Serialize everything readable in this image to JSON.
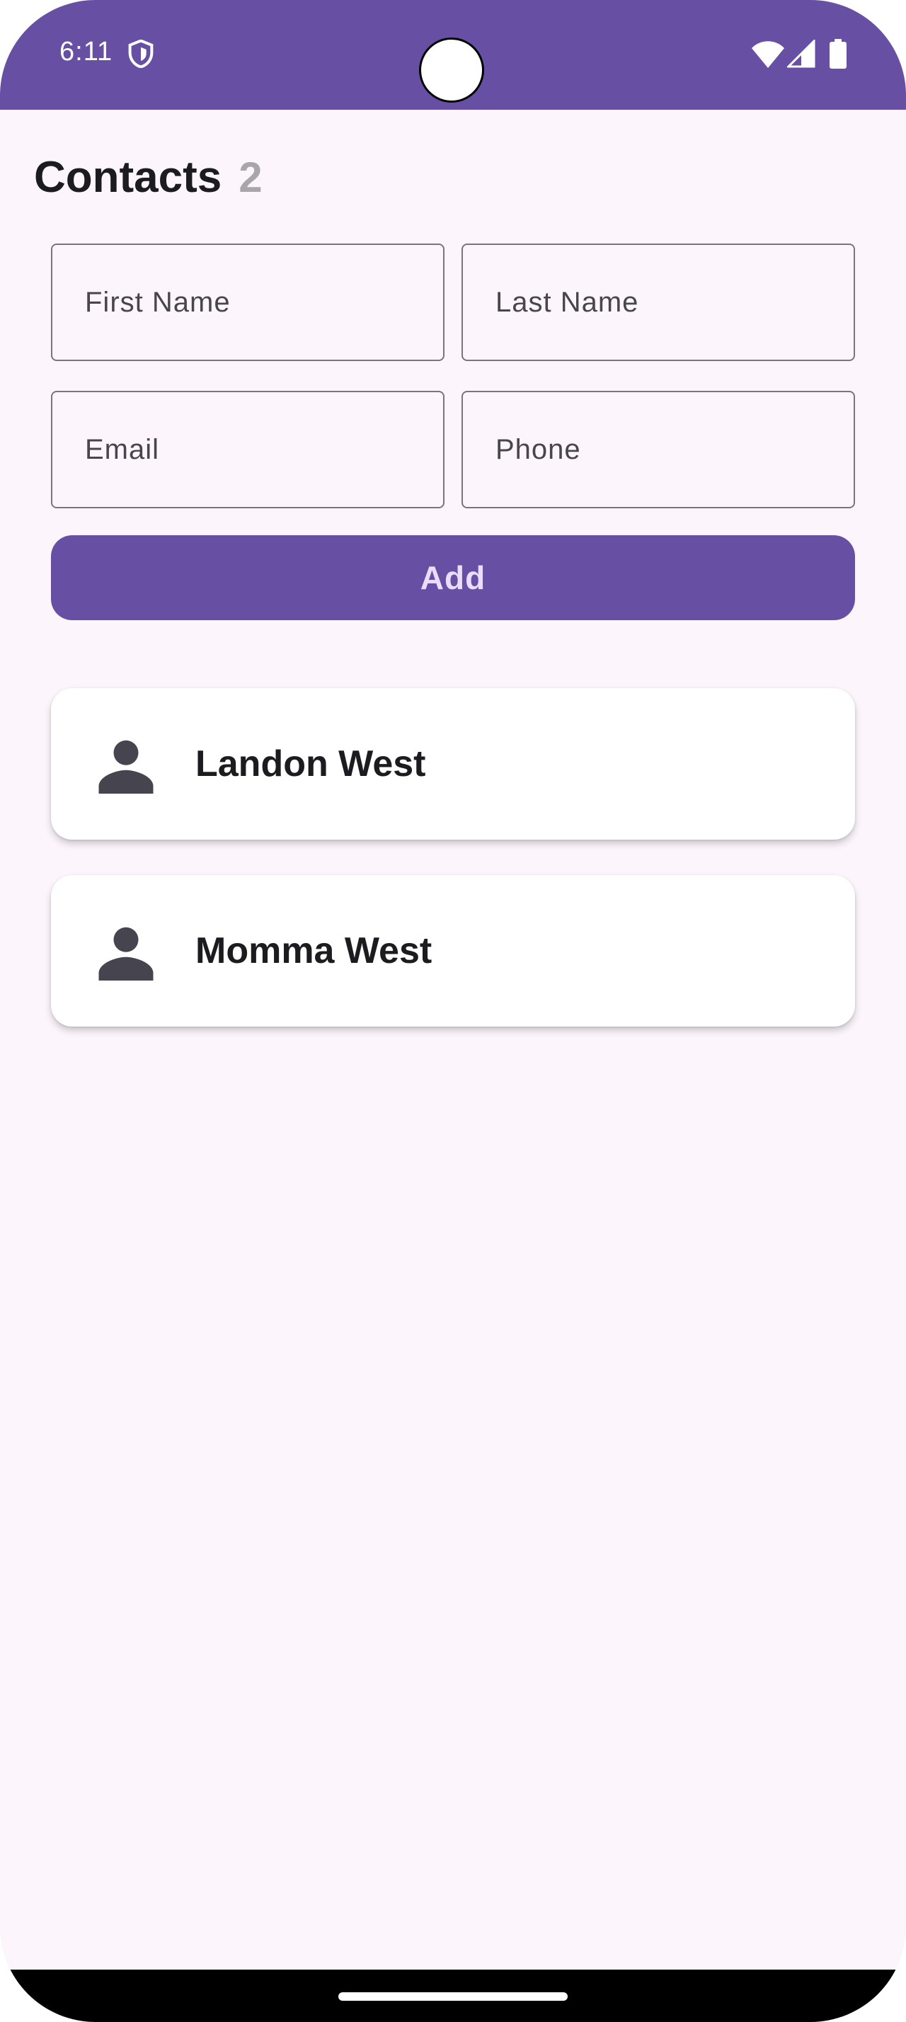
{
  "status_bar": {
    "time": "6:11",
    "bg_color": "#6750a4",
    "icons": [
      "shield-icon",
      "wifi-icon",
      "signal-icon",
      "battery-icon"
    ]
  },
  "header": {
    "title": "Contacts",
    "count": "2"
  },
  "form": {
    "first_name_placeholder": "First Name",
    "last_name_placeholder": "Last Name",
    "email_placeholder": "Email",
    "phone_placeholder": "Phone",
    "add_label": "Add"
  },
  "contacts": [
    {
      "name": "Landon West",
      "icon": "person-icon"
    },
    {
      "name": "Momma West",
      "icon": "person-icon"
    }
  ],
  "colors": {
    "accent": "#6750a4",
    "background": "#fcf5fc",
    "card": "#ffffff"
  }
}
